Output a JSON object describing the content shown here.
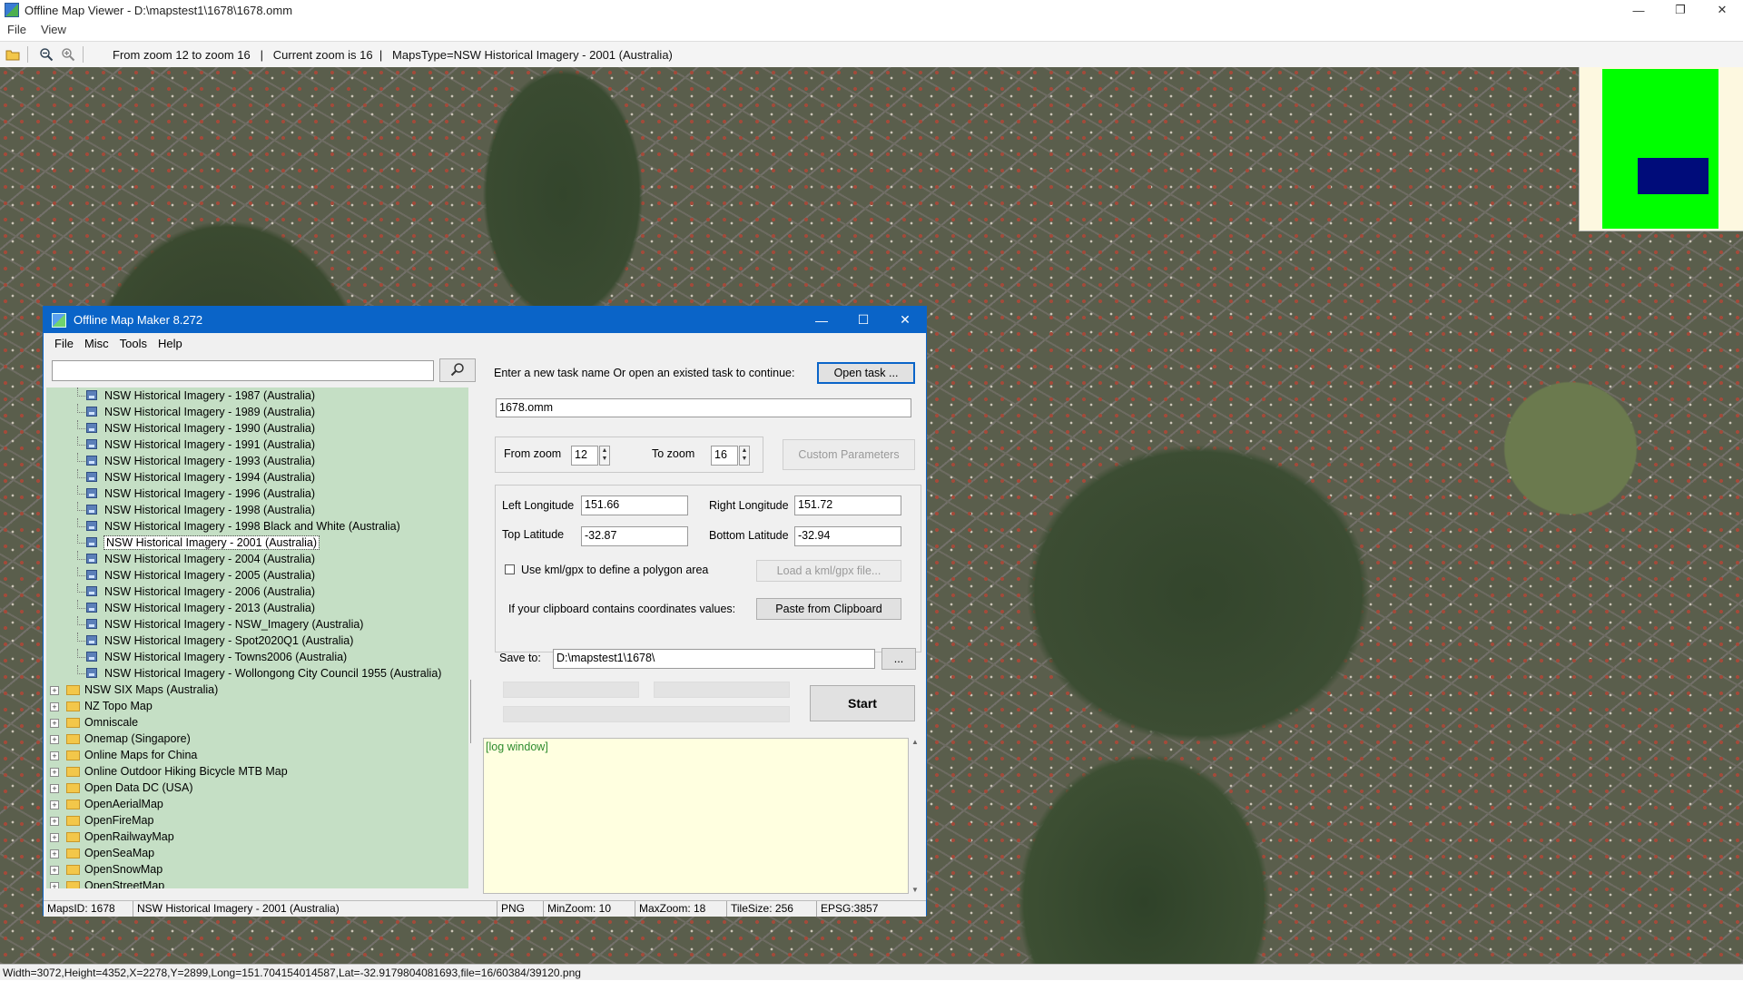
{
  "window": {
    "title": "Offline Map Viewer - D:\\mapstest1\\1678\\1678.omm",
    "controls": {
      "minimize": "—",
      "maximize": "❐",
      "close": "✕"
    }
  },
  "menu": [
    "File",
    "View"
  ],
  "toolbar": {
    "info": "From zoom 12 to zoom 16   |   Current zoom is 16  |   MapsType=NSW Historical Imagery - 2001 (Australia)"
  },
  "minimap": {
    "colors": {
      "background": "#fdf8e0",
      "area": "#00ff00",
      "view": "#000c7a"
    }
  },
  "status": "Width=3072,Height=4352,X=2278,Y=2899,Long=151.704154014587,Lat=-32.9179804081693,file=16/60384/39120.png",
  "dialog": {
    "title": "Offline Map Maker 8.272",
    "controls": {
      "minimize": "—",
      "maximize": "☐",
      "close": "✕"
    },
    "menu": [
      "File",
      "Misc",
      "Tools",
      "Help"
    ],
    "search": {
      "value": "",
      "icon": "search-icon"
    },
    "tree": {
      "children": [
        {
          "label": "NSW Historical Imagery - 1987 (Australia)",
          "selected": false
        },
        {
          "label": "NSW Historical Imagery - 1989 (Australia)",
          "selected": false
        },
        {
          "label": "NSW Historical Imagery - 1990 (Australia)",
          "selected": false
        },
        {
          "label": "NSW Historical Imagery - 1991 (Australia)",
          "selected": false
        },
        {
          "label": "NSW Historical Imagery - 1993 (Australia)",
          "selected": false
        },
        {
          "label": "NSW Historical Imagery - 1994 (Australia)",
          "selected": false
        },
        {
          "label": "NSW Historical Imagery - 1996 (Australia)",
          "selected": false
        },
        {
          "label": "NSW Historical Imagery - 1998 (Australia)",
          "selected": false
        },
        {
          "label": "NSW Historical Imagery - 1998 Black and White (Australia)",
          "selected": false
        },
        {
          "label": "NSW Historical Imagery - 2001 (Australia)",
          "selected": true
        },
        {
          "label": "NSW Historical Imagery - 2004 (Australia)",
          "selected": false
        },
        {
          "label": "NSW Historical Imagery - 2005 (Australia)",
          "selected": false
        },
        {
          "label": "NSW Historical Imagery - 2006 (Australia)",
          "selected": false
        },
        {
          "label": "NSW Historical Imagery - 2013 (Australia)",
          "selected": false
        },
        {
          "label": "NSW Historical Imagery - NSW_Imagery (Australia)",
          "selected": false
        },
        {
          "label": "NSW Historical Imagery - Spot2020Q1 (Australia)",
          "selected": false
        },
        {
          "label": "NSW Historical Imagery - Towns2006 (Australia)",
          "selected": false
        },
        {
          "label": "NSW Historical Imagery - Wollongong City Council 1955 (Australia)",
          "selected": false
        }
      ],
      "folders": [
        "NSW SIX Maps (Australia)",
        "NZ Topo Map",
        "Omniscale",
        "Onemap (Singapore)",
        "Online Maps for China",
        "Online Outdoor Hiking Bicycle MTB Map",
        "Open Data DC (USA)",
        "OpenAerialMap",
        "OpenFireMap",
        "OpenRailwayMap",
        "OpenSeaMap",
        "OpenSnowMap",
        "OpenStreetMap"
      ]
    },
    "task": {
      "prompt": "Enter a new task name Or open an existed task to continue:",
      "open_button": "Open task ...",
      "name": "1678.omm"
    },
    "zoom": {
      "from_label": "From zoom",
      "from_value": "12",
      "to_label": "To zoom",
      "to_value": "16",
      "custom_button": "Custom Parameters"
    },
    "coords": {
      "left_lon_label": "Left Longitude",
      "left_lon": "151.66",
      "right_lon_label": "Right Longitude",
      "right_lon": "151.72",
      "top_lat_label": "Top Latitude",
      "top_lat": "-32.87",
      "bottom_lat_label": "Bottom Latitude",
      "bottom_lat": "-32.94",
      "kml_label": "Use kml/gpx to define a polygon area",
      "kml_button": "Load a kml/gpx file...",
      "clipboard_label": "If your clipboard contains coordinates values:",
      "clipboard_button": "Paste from Clipboard"
    },
    "save": {
      "label": "Save to:",
      "path": "D:\\mapstest1\\1678\\",
      "browse": "..."
    },
    "start_button": "Start",
    "log": "[log window]",
    "status": {
      "maps_id": "MapsID: 1678",
      "name": "NSW Historical Imagery - 2001 (Australia)",
      "format": "PNG",
      "min_zoom": "MinZoom: 10",
      "max_zoom": "MaxZoom: 18",
      "tile_size": "TileSize: 256",
      "epsg": "EPSG:3857"
    }
  }
}
